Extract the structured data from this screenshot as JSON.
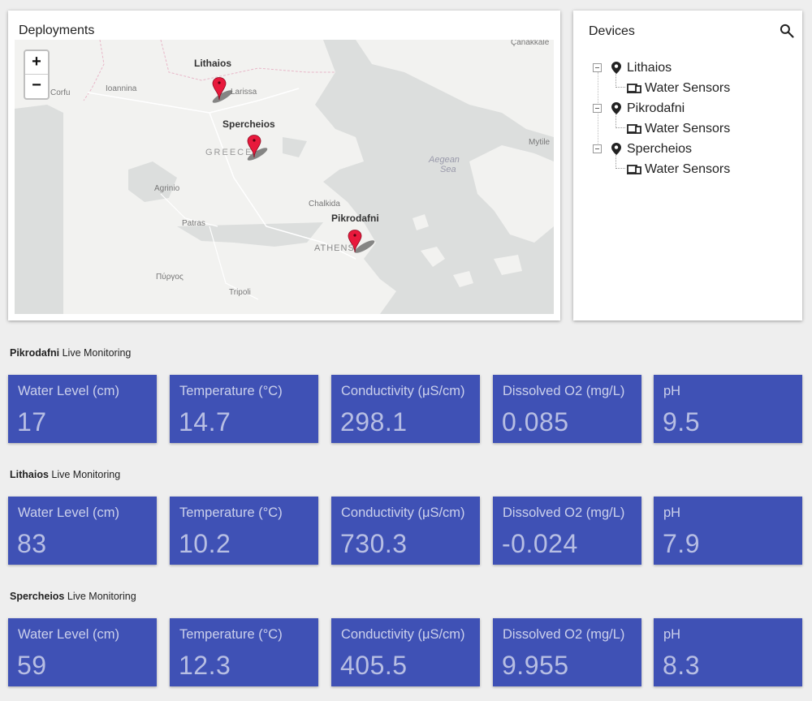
{
  "deployments": {
    "title": "Deployments",
    "zoom_in": "+",
    "zoom_out": "−",
    "markers": [
      {
        "label": "Lithaios"
      },
      {
        "label": "Spercheios"
      },
      {
        "label": "Pikrodafni"
      }
    ],
    "map_labels": {
      "country": "GREECE",
      "sea": "Aegean",
      "sea2": "Sea",
      "athens": "ATHENS",
      "places": [
        "Ioannina",
        "Corfu",
        "Larissa",
        "Agrinio",
        "Patras",
        "Πύργος",
        "Tripoli",
        "Chalkida",
        "Mytile",
        "Çanakkale"
      ]
    }
  },
  "devices": {
    "title": "Devices",
    "search_icon": "search-icon",
    "tree": [
      {
        "label": "Lithaios",
        "child": "Water Sensors"
      },
      {
        "label": "Pikrodafni",
        "child": "Water Sensors"
      },
      {
        "label": "Spercheios",
        "child": "Water Sensors"
      }
    ]
  },
  "colors": {
    "accent": "#3f51b5",
    "marker": "#e8193c",
    "background": "#eeeeee"
  },
  "monitoring": [
    {
      "site": "Pikrodafni",
      "suffix": "Live Monitoring",
      "metrics": [
        {
          "label": "Water Level (cm)",
          "value": "17"
        },
        {
          "label": "Temperature (°C)",
          "value": "14.7"
        },
        {
          "label": "Conductivity (μS/cm)",
          "value": "298.1"
        },
        {
          "label": "Dissolved O2 (mg/L)",
          "value": "0.085"
        },
        {
          "label": "pH",
          "value": "9.5"
        }
      ]
    },
    {
      "site": "Lithaios",
      "suffix": "Live Monitoring",
      "metrics": [
        {
          "label": "Water Level (cm)",
          "value": "83"
        },
        {
          "label": "Temperature (°C)",
          "value": "10.2"
        },
        {
          "label": "Conductivity (μS/cm)",
          "value": "730.3"
        },
        {
          "label": "Dissolved O2 (mg/L)",
          "value": "-0.024"
        },
        {
          "label": "pH",
          "value": "7.9"
        }
      ]
    },
    {
      "site": "Spercheios",
      "suffix": "Live Monitoring",
      "metrics": [
        {
          "label": "Water Level (cm)",
          "value": "59"
        },
        {
          "label": "Temperature (°C)",
          "value": "12.3"
        },
        {
          "label": "Conductivity (μS/cm)",
          "value": "405.5"
        },
        {
          "label": "Dissolved O2 (mg/L)",
          "value": "9.955"
        },
        {
          "label": "pH",
          "value": "8.3"
        }
      ]
    }
  ]
}
